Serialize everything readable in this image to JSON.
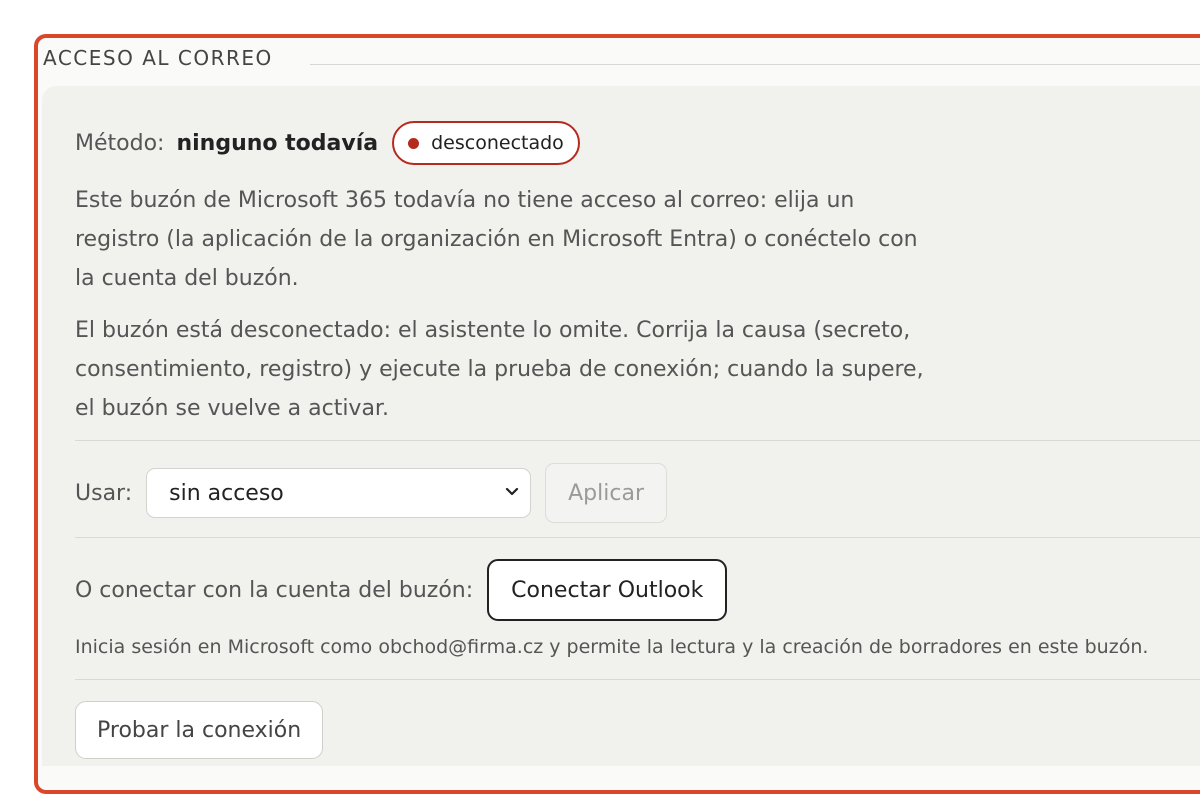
{
  "section": {
    "legend": "ACCESO AL CORREO"
  },
  "method": {
    "label": "Método:",
    "value": "ninguno todavía",
    "status_badge": "desconectado",
    "status_color": "#b62a1e"
  },
  "description": {
    "paragraph1": "Este buzón de Microsoft 365 todavía no tiene acceso al correo: elija un registro (la aplicación de la organización en Microsoft Entra) o conéctelo con la cuenta del buzón.",
    "paragraph2": "El buzón está desconectado: el asistente lo omite. Corrija la causa (secreto, consentimiento, registro) y ejecute la prueba de conexión; cuando la supere, el buzón se vuelve a activar."
  },
  "use": {
    "label": "Usar:",
    "selected": "sin acceso",
    "apply_label": "Aplicar"
  },
  "connect": {
    "label": "O conectar con la cuenta del buzón:",
    "button_label": "Conectar Outlook",
    "hint": "Inicia sesión en Microsoft como obchod@firma.cz y permite la lectura y la creación de borradores en este buzón."
  },
  "test": {
    "button_label": "Probar la conexión"
  },
  "colors": {
    "frame_accent": "#d9472b"
  }
}
